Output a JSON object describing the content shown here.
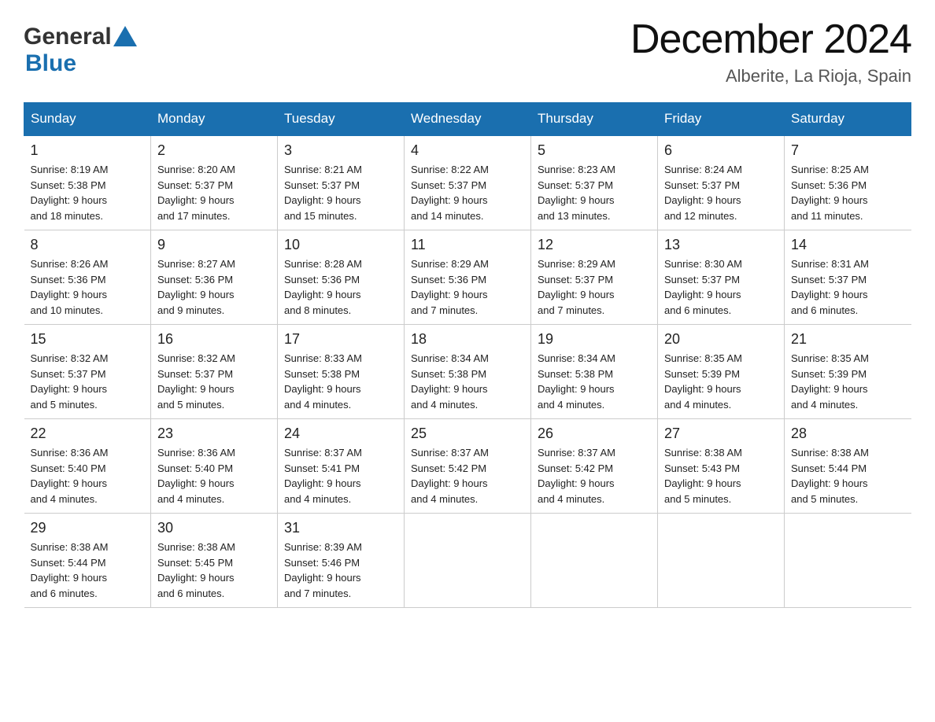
{
  "header": {
    "logo_general": "General",
    "logo_blue": "Blue",
    "month": "December 2024",
    "location": "Alberite, La Rioja, Spain"
  },
  "days_of_week": [
    "Sunday",
    "Monday",
    "Tuesday",
    "Wednesday",
    "Thursday",
    "Friday",
    "Saturday"
  ],
  "weeks": [
    [
      {
        "day": "1",
        "sunrise": "8:19 AM",
        "sunset": "5:38 PM",
        "daylight": "9 hours and 18 minutes."
      },
      {
        "day": "2",
        "sunrise": "8:20 AM",
        "sunset": "5:37 PM",
        "daylight": "9 hours and 17 minutes."
      },
      {
        "day": "3",
        "sunrise": "8:21 AM",
        "sunset": "5:37 PM",
        "daylight": "9 hours and 15 minutes."
      },
      {
        "day": "4",
        "sunrise": "8:22 AM",
        "sunset": "5:37 PM",
        "daylight": "9 hours and 14 minutes."
      },
      {
        "day": "5",
        "sunrise": "8:23 AM",
        "sunset": "5:37 PM",
        "daylight": "9 hours and 13 minutes."
      },
      {
        "day": "6",
        "sunrise": "8:24 AM",
        "sunset": "5:37 PM",
        "daylight": "9 hours and 12 minutes."
      },
      {
        "day": "7",
        "sunrise": "8:25 AM",
        "sunset": "5:36 PM",
        "daylight": "9 hours and 11 minutes."
      }
    ],
    [
      {
        "day": "8",
        "sunrise": "8:26 AM",
        "sunset": "5:36 PM",
        "daylight": "9 hours and 10 minutes."
      },
      {
        "day": "9",
        "sunrise": "8:27 AM",
        "sunset": "5:36 PM",
        "daylight": "9 hours and 9 minutes."
      },
      {
        "day": "10",
        "sunrise": "8:28 AM",
        "sunset": "5:36 PM",
        "daylight": "9 hours and 8 minutes."
      },
      {
        "day": "11",
        "sunrise": "8:29 AM",
        "sunset": "5:36 PM",
        "daylight": "9 hours and 7 minutes."
      },
      {
        "day": "12",
        "sunrise": "8:29 AM",
        "sunset": "5:37 PM",
        "daylight": "9 hours and 7 minutes."
      },
      {
        "day": "13",
        "sunrise": "8:30 AM",
        "sunset": "5:37 PM",
        "daylight": "9 hours and 6 minutes."
      },
      {
        "day": "14",
        "sunrise": "8:31 AM",
        "sunset": "5:37 PM",
        "daylight": "9 hours and 6 minutes."
      }
    ],
    [
      {
        "day": "15",
        "sunrise": "8:32 AM",
        "sunset": "5:37 PM",
        "daylight": "9 hours and 5 minutes."
      },
      {
        "day": "16",
        "sunrise": "8:32 AM",
        "sunset": "5:37 PM",
        "daylight": "9 hours and 5 minutes."
      },
      {
        "day": "17",
        "sunrise": "8:33 AM",
        "sunset": "5:38 PM",
        "daylight": "9 hours and 4 minutes."
      },
      {
        "day": "18",
        "sunrise": "8:34 AM",
        "sunset": "5:38 PM",
        "daylight": "9 hours and 4 minutes."
      },
      {
        "day": "19",
        "sunrise": "8:34 AM",
        "sunset": "5:38 PM",
        "daylight": "9 hours and 4 minutes."
      },
      {
        "day": "20",
        "sunrise": "8:35 AM",
        "sunset": "5:39 PM",
        "daylight": "9 hours and 4 minutes."
      },
      {
        "day": "21",
        "sunrise": "8:35 AM",
        "sunset": "5:39 PM",
        "daylight": "9 hours and 4 minutes."
      }
    ],
    [
      {
        "day": "22",
        "sunrise": "8:36 AM",
        "sunset": "5:40 PM",
        "daylight": "9 hours and 4 minutes."
      },
      {
        "day": "23",
        "sunrise": "8:36 AM",
        "sunset": "5:40 PM",
        "daylight": "9 hours and 4 minutes."
      },
      {
        "day": "24",
        "sunrise": "8:37 AM",
        "sunset": "5:41 PM",
        "daylight": "9 hours and 4 minutes."
      },
      {
        "day": "25",
        "sunrise": "8:37 AM",
        "sunset": "5:42 PM",
        "daylight": "9 hours and 4 minutes."
      },
      {
        "day": "26",
        "sunrise": "8:37 AM",
        "sunset": "5:42 PM",
        "daylight": "9 hours and 4 minutes."
      },
      {
        "day": "27",
        "sunrise": "8:38 AM",
        "sunset": "5:43 PM",
        "daylight": "9 hours and 5 minutes."
      },
      {
        "day": "28",
        "sunrise": "8:38 AM",
        "sunset": "5:44 PM",
        "daylight": "9 hours and 5 minutes."
      }
    ],
    [
      {
        "day": "29",
        "sunrise": "8:38 AM",
        "sunset": "5:44 PM",
        "daylight": "9 hours and 6 minutes."
      },
      {
        "day": "30",
        "sunrise": "8:38 AM",
        "sunset": "5:45 PM",
        "daylight": "9 hours and 6 minutes."
      },
      {
        "day": "31",
        "sunrise": "8:39 AM",
        "sunset": "5:46 PM",
        "daylight": "9 hours and 7 minutes."
      },
      null,
      null,
      null,
      null
    ]
  ],
  "labels": {
    "sunrise": "Sunrise:",
    "sunset": "Sunset:",
    "daylight": "Daylight:"
  }
}
